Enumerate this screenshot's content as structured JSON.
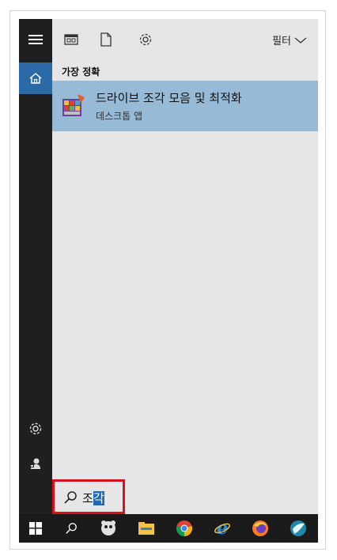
{
  "filter": {
    "label": "필터"
  },
  "section": {
    "best_match": "가장 정확"
  },
  "result": {
    "title": "드라이브 조각 모음 및 최적화",
    "subtitle": "데스크톱 앱"
  },
  "search": {
    "typed": "조",
    "selected": "각"
  },
  "colors": {
    "accent": "#2b6aa7",
    "selected_result": "#97bad6",
    "highlight_box": "#d9101a"
  },
  "icons": {
    "rail": [
      "hamburger-icon",
      "home-icon",
      "settings-icon",
      "user-icon"
    ],
    "toolbar": [
      "apps-icon",
      "documents-icon",
      "settings-icon"
    ],
    "taskbar": [
      "windows-start-icon",
      "search-icon",
      "app-icon",
      "file-explorer-icon",
      "chrome-icon",
      "internet-explorer-icon",
      "firefox-icon",
      "app-icon"
    ]
  }
}
